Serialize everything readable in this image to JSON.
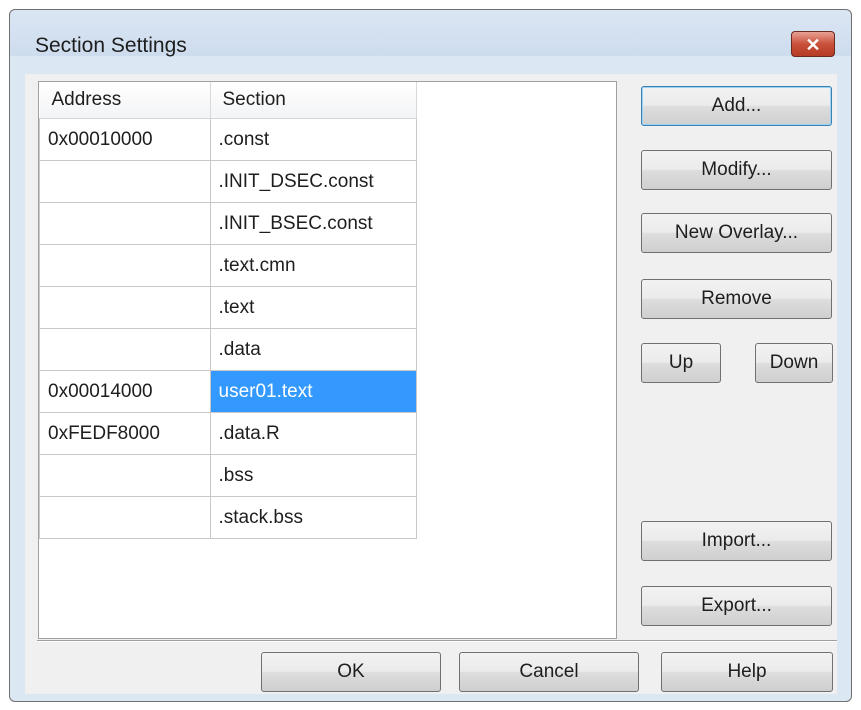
{
  "dialog": {
    "title": "Section Settings",
    "close_glyph": "✕"
  },
  "table": {
    "headers": {
      "address": "Address",
      "section": "Section"
    },
    "rows": [
      {
        "address": "0x00010000",
        "section": ".const"
      },
      {
        "address": "",
        "section": ".INIT_DSEC.const"
      },
      {
        "address": "",
        "section": ".INIT_BSEC.const"
      },
      {
        "address": "",
        "section": ".text.cmn"
      },
      {
        "address": "",
        "section": ".text"
      },
      {
        "address": "",
        "section": ".data"
      },
      {
        "address": "0x00014000",
        "section": "user01.text"
      },
      {
        "address": "0xFEDF8000",
        "section": ".data.R"
      },
      {
        "address": "",
        "section": ".bss"
      },
      {
        "address": "",
        "section": ".stack.bss"
      }
    ],
    "selected_row": 6,
    "selection_color": "#3399ff"
  },
  "buttons": {
    "add": "Add...",
    "modify": "Modify...",
    "new_overlay": "New Overlay...",
    "remove": "Remove",
    "up": "Up",
    "down": "Down",
    "import": "Import...",
    "export": "Export...",
    "ok": "OK",
    "cancel": "Cancel",
    "help": "Help"
  }
}
